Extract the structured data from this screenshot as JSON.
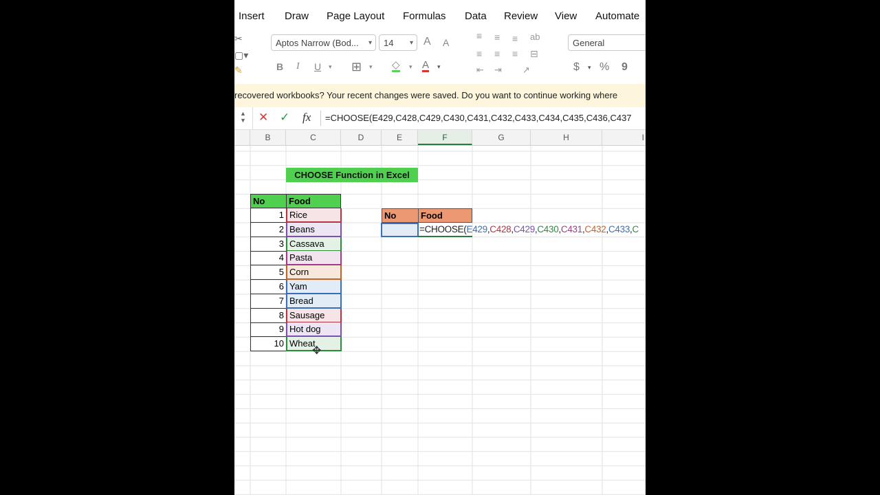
{
  "menu": [
    "Insert",
    "Draw",
    "Page Layout",
    "Formulas",
    "Data",
    "Review",
    "View",
    "Automate"
  ],
  "ribbon": {
    "font_name": "Aptos Narrow (Bod...",
    "font_size": "14",
    "number_format": "General",
    "bold": "B",
    "italic": "I",
    "underline": "U",
    "increase_font": "A",
    "decrease_font": "A",
    "currency": "$",
    "percent": "%",
    "comma": "9"
  },
  "infobar": {
    "text": "recovered workbooks?  Your recent changes were saved. Do you want to continue working where"
  },
  "formula_bar": {
    "cancel": "✕",
    "accept": "✓",
    "fx": "fx",
    "formula": "=CHOOSE(E429,C428,C429,C430,C431,C432,C433,C434,C435,C436,C437"
  },
  "columns": [
    "B",
    "C",
    "D",
    "E",
    "F",
    "G",
    "H",
    "I"
  ],
  "sheet": {
    "title": "CHOOSE Function in Excel",
    "table_headers": {
      "no": "No",
      "food": "Food"
    },
    "rows": [
      {
        "no": "1",
        "food": "Rice"
      },
      {
        "no": "2",
        "food": "Beans"
      },
      {
        "no": "3",
        "food": "Cassava"
      },
      {
        "no": "4",
        "food": "Pasta"
      },
      {
        "no": "5",
        "food": "Corn"
      },
      {
        "no": "6",
        "food": "Yam"
      },
      {
        "no": "7",
        "food": "Bread"
      },
      {
        "no": "8",
        "food": "Sausage"
      },
      {
        "no": "9",
        "food": "Hot dog"
      },
      {
        "no": "10",
        "food": "Wheat"
      }
    ],
    "lookup_headers": {
      "no": "No",
      "food": "Food"
    },
    "lookup_formula_parts": [
      "=CHOOSE(",
      "E429",
      ",",
      "C428",
      ",",
      "C429",
      ",",
      "C430",
      ",",
      "C431",
      ",",
      "C432",
      ",",
      "C433",
      ",",
      "C"
    ]
  },
  "colors": {
    "title_bg": "#4fd04f",
    "lookup_header_bg": "#eb9873",
    "ref_colors": [
      "#b5343f",
      "#7c4fb0",
      "#2f8a3f",
      "#a03a8a",
      "#c0642a",
      "#3a6fb8",
      "#3a6fb8",
      "#b5343f",
      "#7c4fb0",
      "#2f8a3f"
    ],
    "ref_fills": [
      "#f6e4e6",
      "#ece6f4",
      "#e4f2e6",
      "#f2e4ee",
      "#f8e8dc",
      "#e2ecf6",
      "#e2ecf6",
      "#f6e4e6",
      "#ece6f4",
      "#e4f2e6"
    ]
  }
}
